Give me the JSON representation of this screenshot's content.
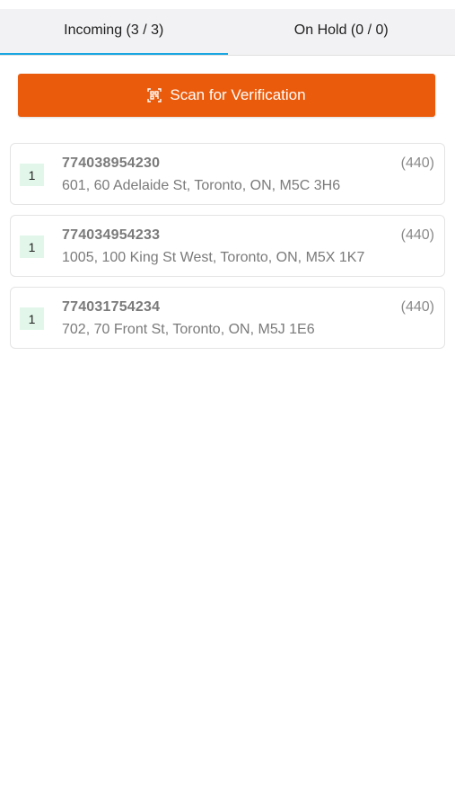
{
  "tabs": [
    {
      "label": "Incoming (3 / 3)",
      "active": true
    },
    {
      "label": "On Hold (0 / 0)",
      "active": false
    }
  ],
  "scan_button": {
    "label": "Scan for Verification",
    "icon": "qr-scan-icon",
    "color": "#ea5b0c"
  },
  "accent_color": "#1aa6e0",
  "shipments": [
    {
      "badge": "1",
      "tracking": "774038954230",
      "count": "(440)",
      "address": "601, 60 Adelaide St, Toronto, ON, M5C 3H6"
    },
    {
      "badge": "1",
      "tracking": "774034954233",
      "count": "(440)",
      "address": "1005, 100 King St West, Toronto, ON, M5X 1K7"
    },
    {
      "badge": "1",
      "tracking": "774031754234",
      "count": "(440)",
      "address": "702, 70 Front St, Toronto, ON, M5J 1E6"
    }
  ]
}
